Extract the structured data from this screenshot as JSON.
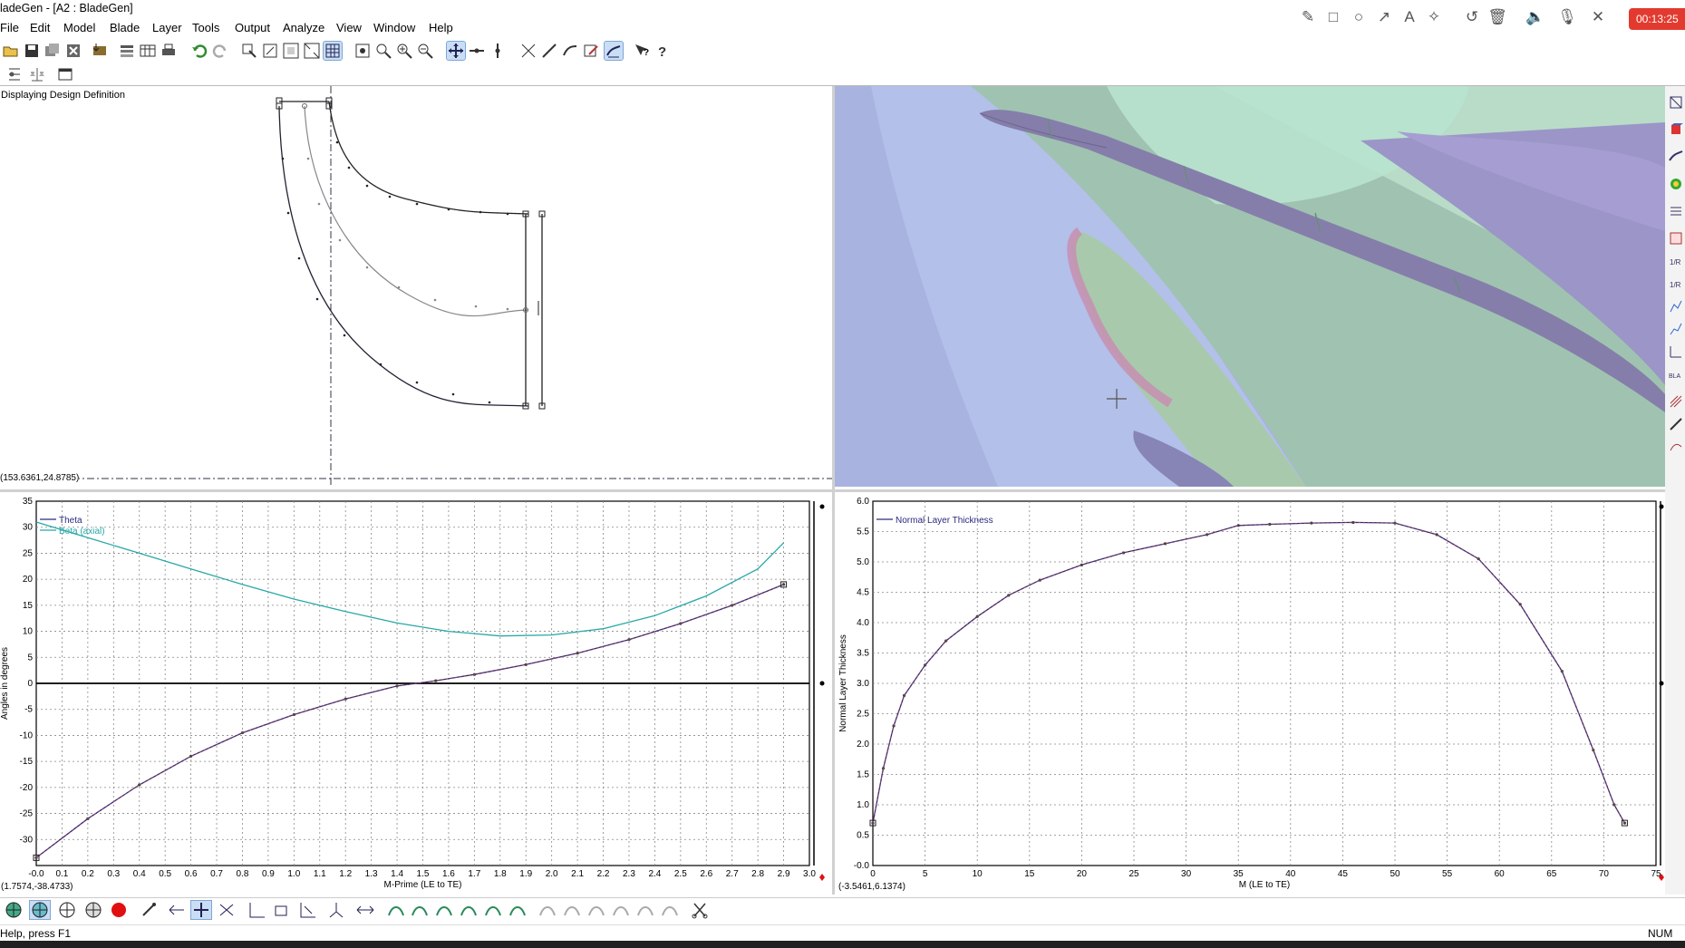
{
  "window": {
    "title": "ladeGen - [A2 : BladeGen]"
  },
  "menu": [
    "File",
    "Edit",
    "Model",
    "Blade",
    "Layer",
    "Tools",
    "Output",
    "Analyze",
    "View",
    "Window",
    "Help"
  ],
  "recorder": {
    "timer": "00:13:25"
  },
  "meridional": {
    "caption": "Displaying Design Definition",
    "coord": "(153.6361,24.8785)"
  },
  "angle_chart": {
    "coord": "(1.7574,-38.4733)",
    "xlabel": "M-Prime (LE to TE)",
    "ylabel": "Angles in degrees",
    "legend": [
      "Theta",
      "Beta (axial)"
    ]
  },
  "thickness_chart": {
    "coord": "(-3.5461,6.1374)",
    "xlabel": "M (LE to TE)",
    "ylabel": "Normal Layer Thickness",
    "legend": [
      "Normal Layer Thickness"
    ]
  },
  "status": {
    "help": "Help, press F1",
    "num": "NUM"
  },
  "chart_data": [
    {
      "type": "line",
      "xlabel": "M-Prime (LE to TE)",
      "ylabel": "Angles in degrees",
      "xlim": [
        0.0,
        3.0
      ],
      "ylim": [
        -35,
        35
      ],
      "xticks": [
        "-0.0",
        "0.1",
        "0.2",
        "0.3",
        "0.4",
        "0.5",
        "0.6",
        "0.7",
        "0.8",
        "0.9",
        "1.0",
        "1.1",
        "1.2",
        "1.3",
        "1.4",
        "1.5",
        "1.6",
        "1.7",
        "1.8",
        "1.9",
        "2.0",
        "2.1",
        "2.2",
        "2.3",
        "2.4",
        "2.5",
        "2.6",
        "2.7",
        "2.8",
        "2.9",
        "3.0"
      ],
      "yticks": [
        "35",
        "30",
        "25",
        "20",
        "15",
        "10",
        "5",
        "0",
        "-5",
        "-10",
        "-15",
        "-20",
        "-25",
        "-30"
      ],
      "grid": true,
      "legend_position": "top-left",
      "series": [
        {
          "name": "Theta",
          "color": "#2a2a80",
          "x": [
            0.0,
            0.2,
            0.4,
            0.6,
            0.8,
            1.0,
            1.2,
            1.4,
            1.55,
            1.7,
            1.9,
            2.1,
            2.3,
            2.5,
            2.7,
            2.9
          ],
          "y": [
            -33.5,
            -26,
            -19.5,
            -14,
            -9.5,
            -6,
            -3,
            -0.5,
            0.5,
            1.7,
            3.6,
            5.8,
            8.4,
            11.5,
            15,
            19
          ]
        },
        {
          "name": "Beta (axial)",
          "color": "#28a8a8",
          "x": [
            0.0,
            0.2,
            0.4,
            0.6,
            0.8,
            1.0,
            1.2,
            1.4,
            1.6,
            1.8,
            2.0,
            2.2,
            2.4,
            2.6,
            2.8,
            2.9
          ],
          "y": [
            31,
            28,
            25,
            22,
            19,
            16.2,
            13.8,
            11.6,
            10,
            9.1,
            9.3,
            10.5,
            13,
            16.8,
            22,
            27
          ]
        }
      ]
    },
    {
      "type": "line",
      "xlabel": "M (LE to TE)",
      "ylabel": "Normal Layer Thickness",
      "xlim": [
        0,
        75
      ],
      "ylim": [
        0,
        6
      ],
      "xticks": [
        "0",
        "5",
        "10",
        "15",
        "20",
        "25",
        "30",
        "35",
        "40",
        "45",
        "50",
        "55",
        "60",
        "65",
        "70",
        "75"
      ],
      "yticks": [
        "6.0",
        "5.5",
        "5.0",
        "4.5",
        "4.0",
        "3.5",
        "3.0",
        "2.5",
        "2.0",
        "1.5",
        "1.0",
        "0.5",
        "-0.0"
      ],
      "grid": true,
      "legend_position": "top-left",
      "series": [
        {
          "name": "Normal Layer Thickness",
          "color": "#2a2a80",
          "x": [
            0,
            1,
            2,
            3,
            5,
            7,
            10,
            13,
            16,
            20,
            24,
            28,
            32,
            35,
            38,
            42,
            46,
            50,
            54,
            58,
            62,
            66,
            69,
            71,
            72
          ],
          "y": [
            0.7,
            1.6,
            2.3,
            2.8,
            3.3,
            3.7,
            4.1,
            4.45,
            4.7,
            4.95,
            5.15,
            5.3,
            5.45,
            5.6,
            5.62,
            5.64,
            5.65,
            5.64,
            5.45,
            5.05,
            4.3,
            3.2,
            1.9,
            1.0,
            0.7
          ]
        }
      ]
    }
  ]
}
